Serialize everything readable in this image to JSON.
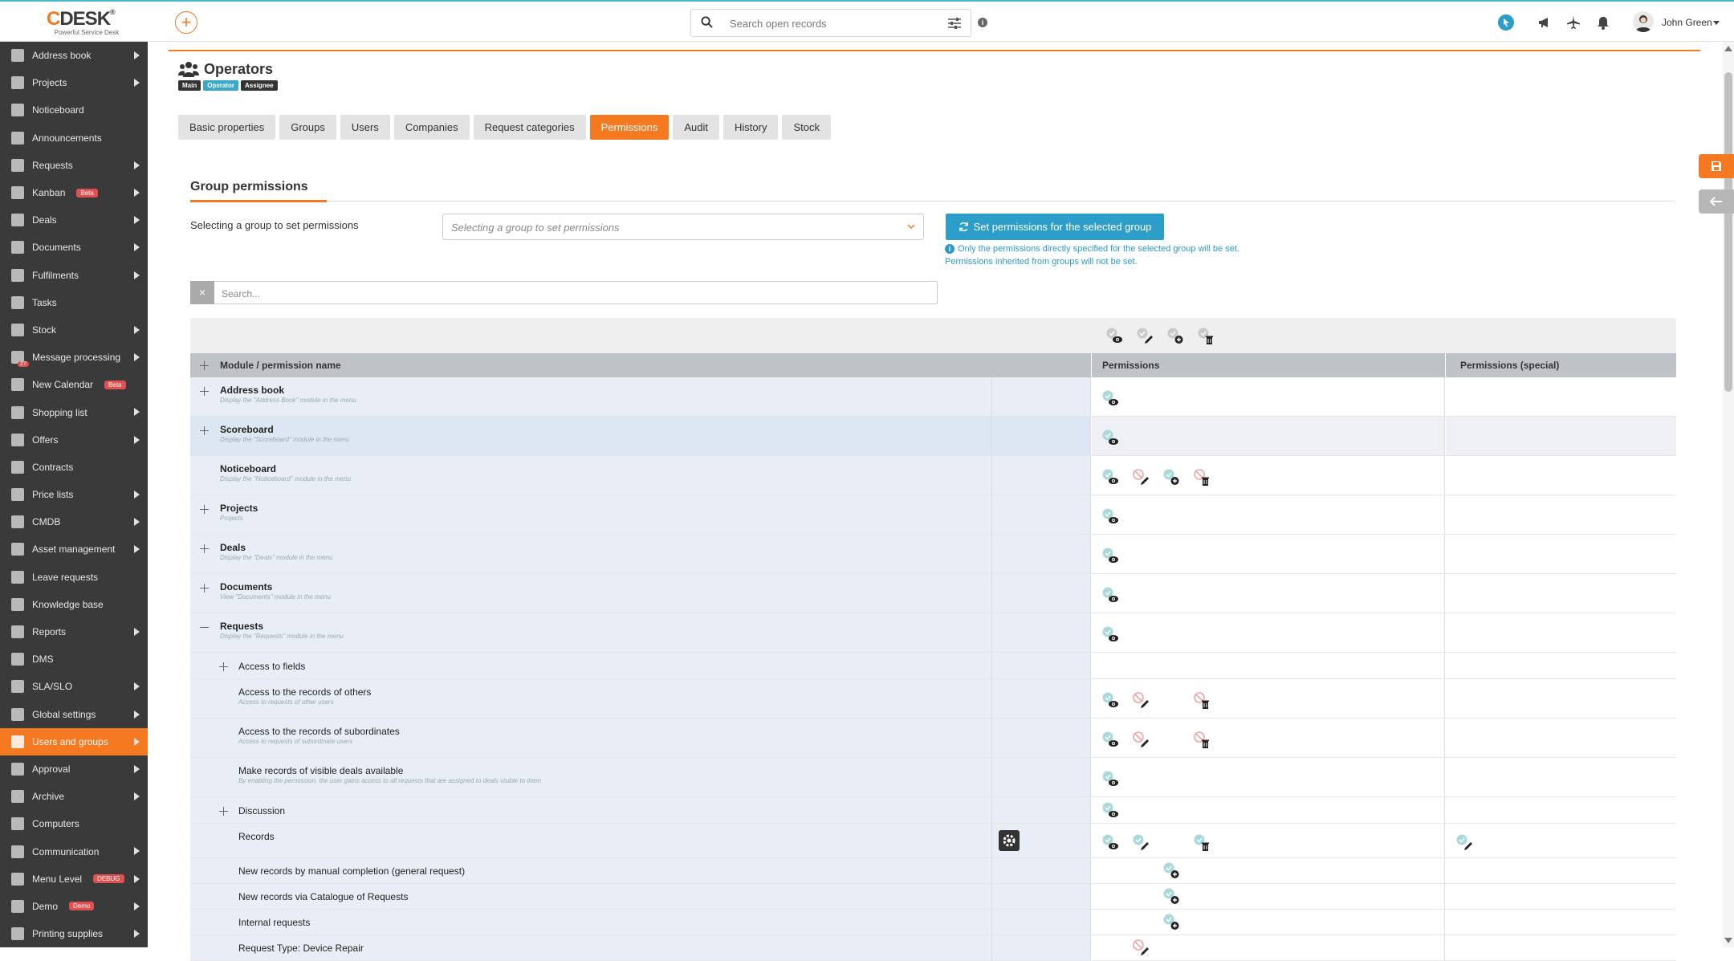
{
  "brand": {
    "name_c": "C",
    "name_rest": "DESK",
    "reg": "®",
    "tagline": "Powerful Service Desk"
  },
  "search": {
    "placeholder": "Search open records"
  },
  "user": {
    "name": "John Green"
  },
  "sidebar": {
    "items": [
      {
        "label": "Address book",
        "arrow": true
      },
      {
        "label": "Projects",
        "arrow": true
      },
      {
        "label": "Noticeboard",
        "arrow": false
      },
      {
        "label": "Announcements",
        "arrow": false
      },
      {
        "label": "Requests",
        "arrow": true
      },
      {
        "label": "Kanban",
        "arrow": true,
        "badge": "Beta"
      },
      {
        "label": "Deals",
        "arrow": true
      },
      {
        "label": "Documents",
        "arrow": true
      },
      {
        "label": "Fulfilments",
        "arrow": true
      },
      {
        "label": "Tasks",
        "arrow": false
      },
      {
        "label": "Stock",
        "arrow": true
      },
      {
        "label": "Message processing",
        "arrow": true,
        "count": "27"
      },
      {
        "label": "New Calendar",
        "arrow": false,
        "badge": "Beta"
      },
      {
        "label": "Shopping list",
        "arrow": true
      },
      {
        "label": "Offers",
        "arrow": true
      },
      {
        "label": "Contracts",
        "arrow": false
      },
      {
        "label": "Price lists",
        "arrow": true
      },
      {
        "label": "CMDB",
        "arrow": true
      },
      {
        "label": "Asset management",
        "arrow": true
      },
      {
        "label": "Leave requests",
        "arrow": false
      },
      {
        "label": "Knowledge base",
        "arrow": false
      },
      {
        "label": "Reports",
        "arrow": true
      },
      {
        "label": "DMS",
        "arrow": false
      },
      {
        "label": "SLA/SLO",
        "arrow": true
      },
      {
        "label": "Global settings",
        "arrow": true
      },
      {
        "label": "Users and groups",
        "arrow": true,
        "active": true
      },
      {
        "label": "Approval",
        "arrow": true
      },
      {
        "label": "Archive",
        "arrow": true
      },
      {
        "label": "Computers",
        "arrow": false
      },
      {
        "label": "Communication",
        "arrow": true
      },
      {
        "label": "Menu Level",
        "arrow": true,
        "badge": "DEBUG"
      },
      {
        "label": "Demo",
        "arrow": true,
        "badge": "Demo"
      },
      {
        "label": "Printing supplies",
        "arrow": true
      }
    ]
  },
  "page": {
    "title": "Operators",
    "tags": [
      {
        "label": "Main",
        "color": "#333333"
      },
      {
        "label": "Operator",
        "color": "#3aa8c9"
      },
      {
        "label": "Assignee",
        "color": "#333333"
      }
    ]
  },
  "tabs": [
    "Basic properties",
    "Groups",
    "Users",
    "Companies",
    "Request categories",
    "Permissions",
    "Audit",
    "History",
    "Stock"
  ],
  "active_tab": "Permissions",
  "group_permissions": {
    "title": "Group permissions",
    "select_label": "Selecting a group to set permissions",
    "select_placeholder": "Selecting a group to set permissions",
    "set_button": "Set permissions for the selected group",
    "note_line1": "Only the permissions directly specified for the selected group will be set.",
    "note_line2": "Permissions inherited from groups will not be set.",
    "search_placeholder": "Search..."
  },
  "table": {
    "col_name": "Module / permission name",
    "col_perm": "Permissions",
    "col_special": "Permissions (special)",
    "rows": [
      {
        "name": "Address book",
        "desc": "Display the \"Address Book\" module in the menu",
        "bold": true,
        "toggle": "plus",
        "level": 0,
        "h": 49,
        "perms": [
          "view"
        ]
      },
      {
        "name": "Scoreboard",
        "desc": "Display the \"Scoreboard\" module in the menu",
        "bold": true,
        "toggle": "plus",
        "level": 0,
        "h": 49,
        "hl": true,
        "perms": [
          "view"
        ]
      },
      {
        "name": "Noticeboard",
        "desc": "Display the \"Noticeboard\" module in the menu",
        "bold": true,
        "toggle": "none",
        "level": 0,
        "h": 49,
        "perms": [
          "view",
          "edit-denied",
          "add",
          "delete-denied"
        ]
      },
      {
        "name": "Projects",
        "desc": "Projects",
        "bold": true,
        "toggle": "plus",
        "level": 0,
        "h": 49,
        "perms": [
          "view"
        ]
      },
      {
        "name": "Deals",
        "desc": "Display the \"Deals\" module in the menu",
        "bold": true,
        "toggle": "plus",
        "level": 0,
        "h": 49,
        "perms": [
          "view"
        ]
      },
      {
        "name": "Documents",
        "desc": "View \"Documents\" module in the menu",
        "bold": true,
        "toggle": "plus",
        "level": 0,
        "h": 49,
        "perms": [
          "view"
        ]
      },
      {
        "name": "Requests",
        "desc": "Display the \"Requests\" module in the menu",
        "bold": true,
        "toggle": "minus",
        "level": 0,
        "h": 49,
        "perms": [
          "view"
        ]
      },
      {
        "name": "Access to fields",
        "desc": "",
        "bold": false,
        "toggle": "plus",
        "level": 1,
        "h": 33,
        "perms": []
      },
      {
        "name": "Access to the records of others",
        "desc": "Access to requests of other users",
        "bold": false,
        "toggle": "none",
        "level": 1,
        "h": 49,
        "perms": [
          "view",
          "edit-denied",
          "none",
          "delete-denied"
        ]
      },
      {
        "name": "Access to the records of subordinates",
        "desc": "Access to requests of subordinate users",
        "bold": false,
        "toggle": "none",
        "level": 1,
        "h": 49,
        "perms": [
          "view",
          "edit-denied",
          "none",
          "delete-denied"
        ]
      },
      {
        "name": "Make records of visible deals available",
        "desc": "By enabling the permission, the user gains access to all requests that are assigned to deals visible to them",
        "bold": false,
        "toggle": "none",
        "level": 1,
        "h": 49,
        "perms": [
          "view"
        ]
      },
      {
        "name": "Discussion",
        "desc": "",
        "bold": false,
        "toggle": "plus",
        "level": 1,
        "h": 33,
        "perms": [
          "view"
        ]
      },
      {
        "name": "Records",
        "desc": "",
        "bold": false,
        "toggle": "none",
        "level": 1,
        "h": 43,
        "gear": true,
        "perms": [
          "view",
          "edit",
          "none",
          "delete"
        ],
        "special": [
          "edit"
        ]
      },
      {
        "name": "New records by manual completion (general request)",
        "desc": "",
        "bold": false,
        "toggle": "none",
        "level": 1,
        "h": 32,
        "perms": [
          "none",
          "none",
          "add"
        ]
      },
      {
        "name": "New records via Catalogue of Requests",
        "desc": "",
        "bold": false,
        "toggle": "none",
        "level": 1,
        "h": 32,
        "perms": [
          "none",
          "none",
          "add"
        ]
      },
      {
        "name": "Internal requests",
        "desc": "",
        "bold": false,
        "toggle": "none",
        "level": 1,
        "h": 32,
        "perms": [
          "none",
          "none",
          "add"
        ]
      },
      {
        "name": "Request Type: Device Repair",
        "desc": "",
        "bold": false,
        "toggle": "none",
        "level": 1,
        "h": 32,
        "perms": [
          "none",
          "edit-denied"
        ]
      }
    ]
  }
}
